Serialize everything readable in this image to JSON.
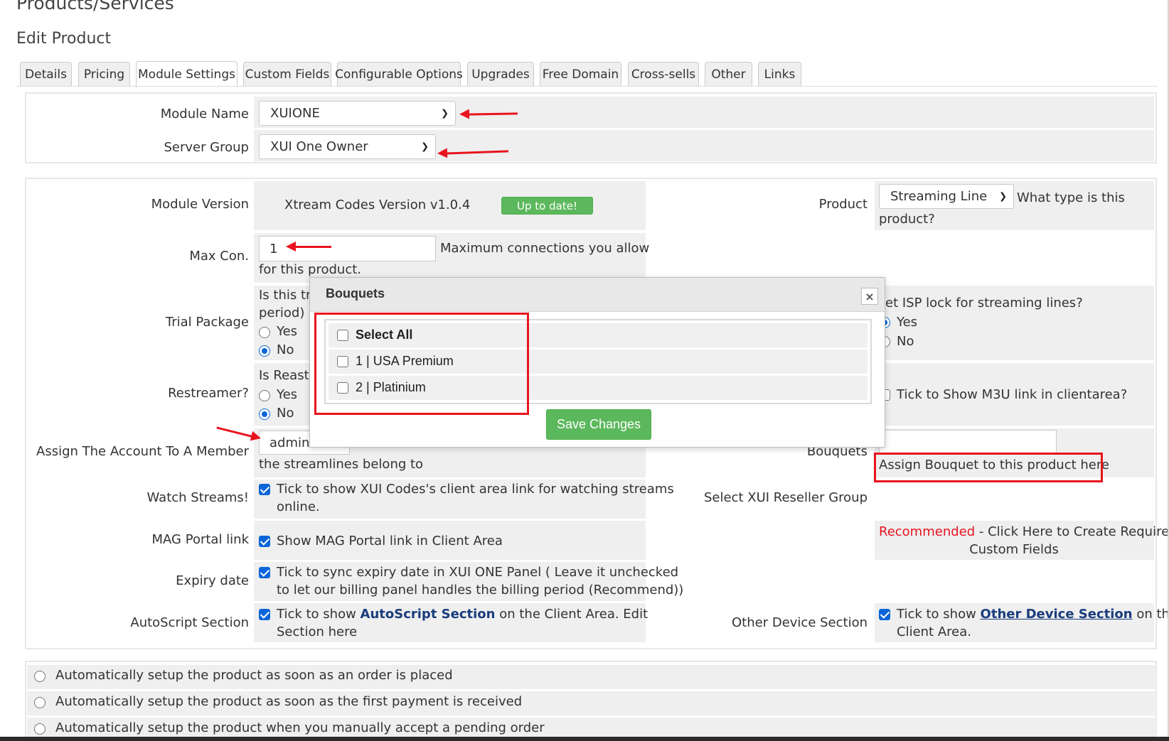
{
  "page": {
    "title": "Products/Services",
    "subtitle": "Edit Product"
  },
  "tabs": [
    "Details",
    "Pricing",
    "Module Settings",
    "Custom Fields",
    "Configurable Options",
    "Upgrades",
    "Free Domain",
    "Cross-sells",
    "Other",
    "Links"
  ],
  "active_tab": "Module Settings",
  "module": {
    "module_name_label": "Module Name",
    "module_name_value": "XUIONE",
    "server_group_label": "Server Group",
    "server_group_value": "XUI One Owner"
  },
  "settings": {
    "module_version_label": "Module Version",
    "module_version_value": "Xtream Codes Version v1.0.4",
    "up_to_date": "Up to date!",
    "max_con_label": "Max Con.",
    "max_con_value": "1",
    "max_con_help_1": "Maximum connections you allow",
    "max_con_help_2": "for this product.",
    "trial_label": "Trial Package",
    "trial_q1": "Is this tri",
    "trial_q2": "period)",
    "yes": "Yes",
    "no": "No",
    "restreamer_label": "Restreamer?",
    "restreamer_q": "Is Reastr",
    "assign_label": "Assign The Account To A Member",
    "assign_value": "admin",
    "assign_help": "the streamlines belong to",
    "watch_label": "Watch Streams!",
    "watch_text_1": "Tick to show XUI Codes's client area link for watching streams",
    "watch_text_2": "online.",
    "mag_label": "MAG Portal link",
    "mag_text": "Show MAG Portal link in Client Area",
    "expiry_label": "Expiry date",
    "expiry_text_1": "Tick to sync expiry date in XUI ONE Panel ( Leave it unchecked",
    "expiry_text_2": "to let our billing panel handles the billing period (Recommend))",
    "autoscript_label": "AutoScript Section",
    "autoscript_pre": "Tick to show ",
    "autoscript_link": "AutoScript Section",
    "autoscript_post": " on the Client Area. Edit",
    "autoscript_text_2": "Section here",
    "product_label": "Product",
    "product_value": "Streaming Line",
    "product_help_1": "What type is this",
    "product_help_2": "product?",
    "isp_text": "et ISP lock for streaming lines?",
    "m3u_text": "Tick to Show M3U link in clientarea?",
    "bouquets_label": "Bouquets",
    "assign_bouquet_link": "Assign Bouquet to this product here",
    "reseller_label": "Select XUI Reseller Group",
    "recommended": "Recommended",
    "create_fields_1": " - Click Here to Create Required",
    "create_fields_2": "Custom Fields",
    "other_device_label": "Other Device Section",
    "other_device_pre": "Tick to show ",
    "other_device_link": "Other Device Section",
    "other_device_post": " on the",
    "other_device_text_2": "Client Area."
  },
  "modal": {
    "title": "Bouquets",
    "close": "×",
    "items": [
      "Select All",
      "1 | USA Premium",
      "2 | Platinium"
    ],
    "save": "Save Changes"
  },
  "setup_options": [
    "Automatically setup the product as soon as an order is placed",
    "Automatically setup the product as soon as the first payment is received",
    "Automatically setup the product when you manually accept a pending order"
  ],
  "colors": {
    "accent_green": "#5cb85c",
    "annotation_red": "#e8141e",
    "link_blue": "#1a3d7c",
    "recommended_red": "#e8141e"
  }
}
